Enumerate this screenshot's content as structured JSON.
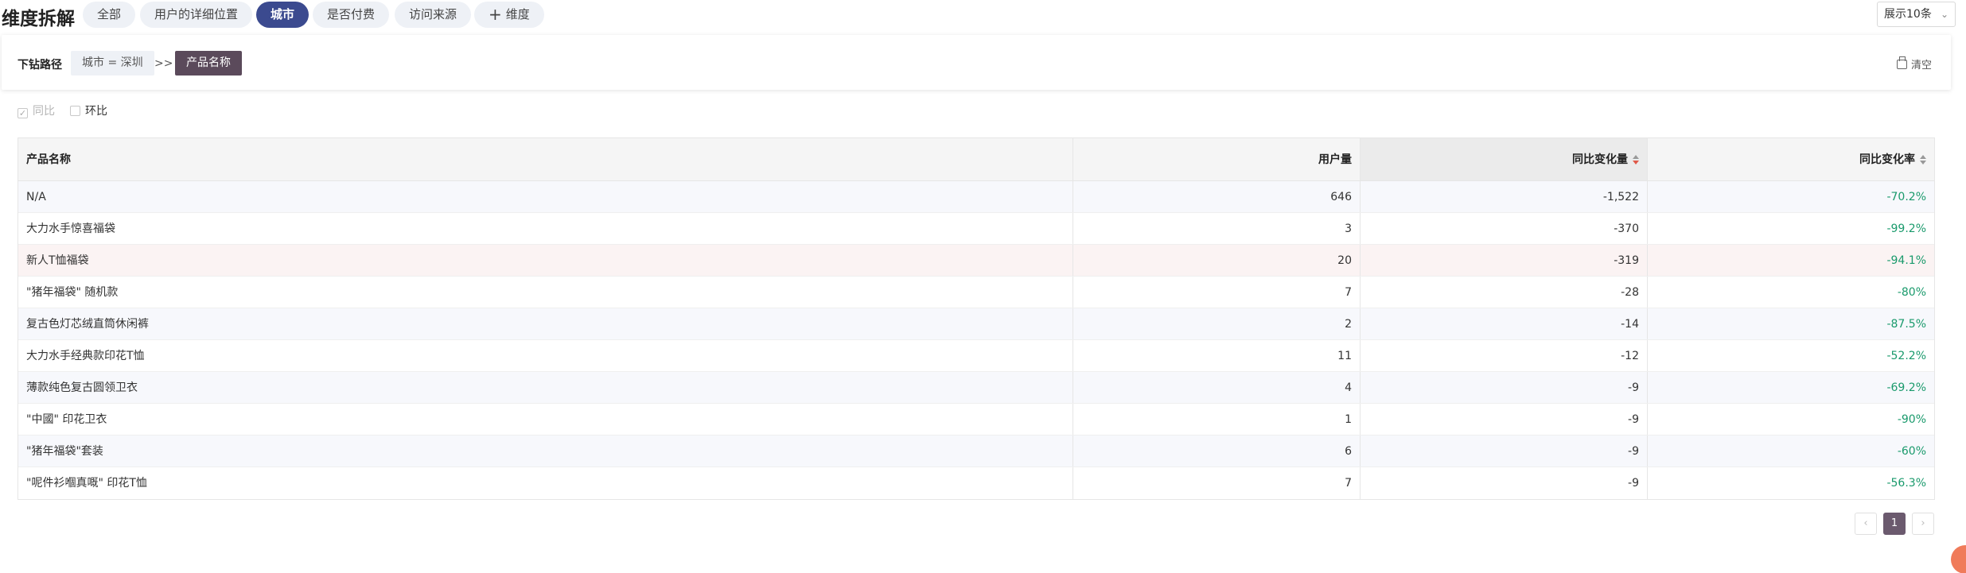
{
  "header": {
    "title": "维度拆解",
    "dimensions": [
      {
        "label": "全部",
        "active": false
      },
      {
        "label": "用户的详细位置",
        "active": false
      },
      {
        "label": "城市",
        "active": true
      },
      {
        "label": "是否付费",
        "active": false
      },
      {
        "label": "访问来源",
        "active": false
      }
    ],
    "add_dimension_label": "维度",
    "page_size": "展示10条"
  },
  "drill": {
    "label": "下钻路径",
    "crumbs": [
      "城市 = 深圳",
      "产品名称"
    ],
    "separator": ">>",
    "clear_label": "清空"
  },
  "compare": {
    "yoy_label": "同比",
    "mom_label": "环比"
  },
  "table": {
    "columns": [
      "产品名称",
      "用户量",
      "同比变化量",
      "同比变化率"
    ],
    "rows": [
      [
        "N/A",
        "646",
        "-1,522",
        "-70.2%"
      ],
      [
        "大力水手惊喜福袋",
        "3",
        "-370",
        "-99.2%"
      ],
      [
        "新人T恤福袋",
        "20",
        "-319",
        "-94.1%"
      ],
      [
        "\"猪年福袋\" 随机款",
        "7",
        "-28",
        "-80%"
      ],
      [
        "复古色灯芯绒直筒休闲裤",
        "2",
        "-14",
        "-87.5%"
      ],
      [
        "大力水手经典款印花T恤",
        "11",
        "-12",
        "-52.2%"
      ],
      [
        "薄款纯色复古圆领卫衣",
        "4",
        "-9",
        "-69.2%"
      ],
      [
        "\"中國\" 印花卫衣",
        "1",
        "-9",
        "-90%"
      ],
      [
        "\"猪年福袋\"套装",
        "6",
        "-9",
        "-60%"
      ],
      [
        "\"呢件衫嗰真嘅\" 印花T恤",
        "7",
        "-9",
        "-56.3%"
      ]
    ]
  },
  "pagination": {
    "prev": "‹",
    "current": "1",
    "next": "›"
  },
  "colors": {
    "accent": "#3b4a8f",
    "crumb_active": "#5b4a5b",
    "negative_rate": "#1a9a6c"
  }
}
